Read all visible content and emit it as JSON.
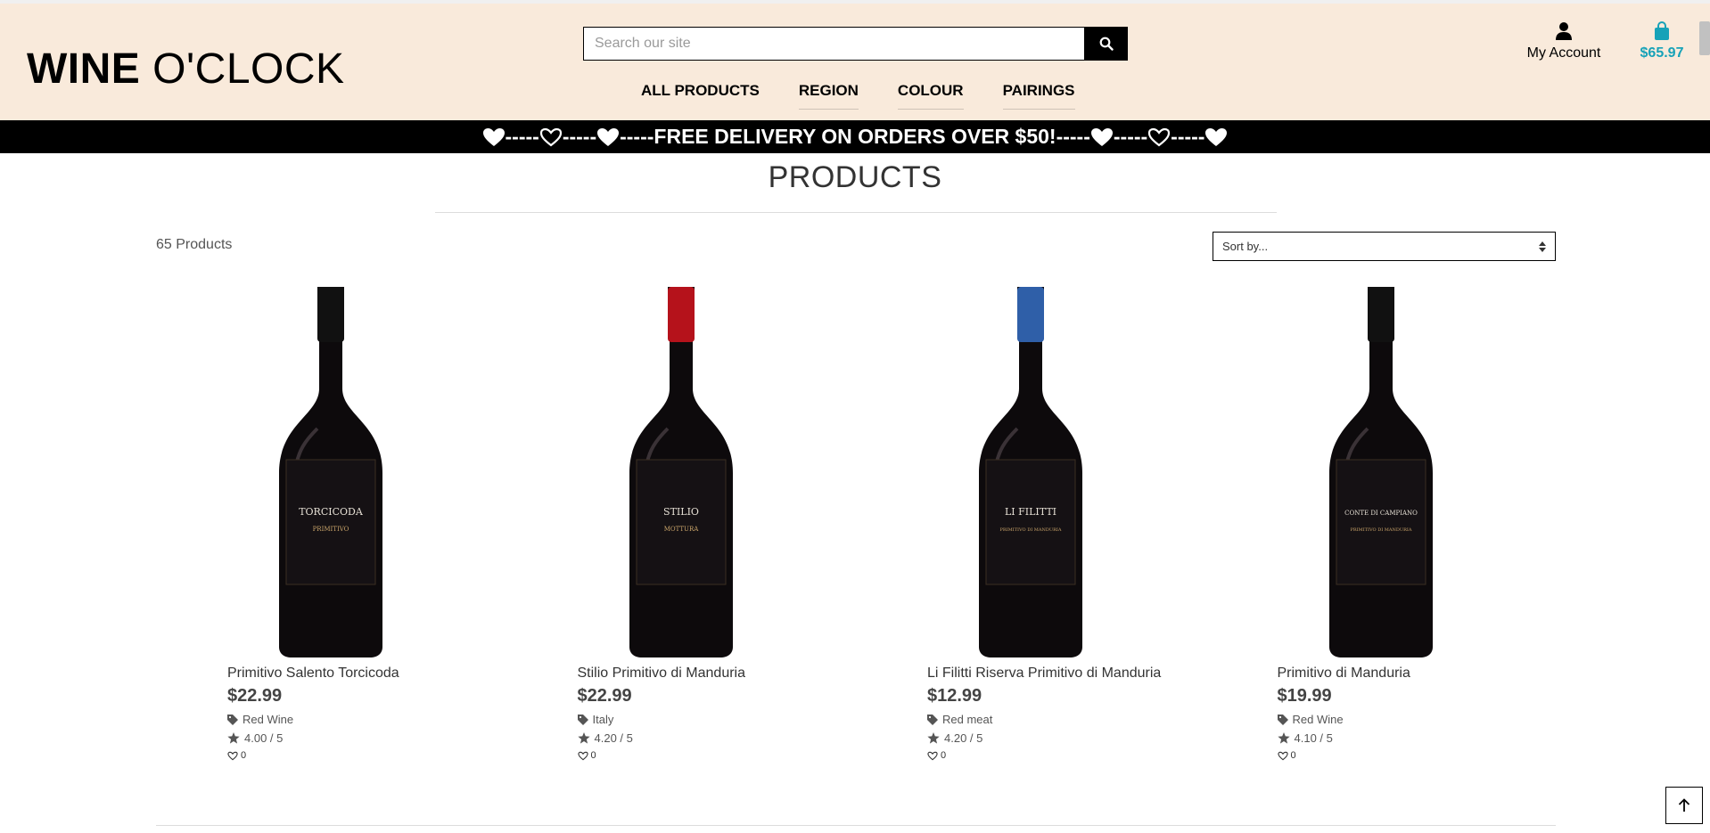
{
  "header": {
    "logo_bold": "WINE",
    "logo_rest": "O'CLOCK",
    "search": {
      "placeholder": "Search our site"
    },
    "nav": [
      {
        "label": "ALL PRODUCTS"
      },
      {
        "label": "REGION"
      },
      {
        "label": "COLOUR"
      },
      {
        "label": "PAIRINGS"
      }
    ],
    "account_label": "My Account",
    "bag_total": "$65.97",
    "bag_color": "#17a2b8"
  },
  "banner": {
    "text": "-----FREE DELIVERY ON ORDERS OVER $50!-----"
  },
  "page": {
    "title": "PRODUCTS",
    "count": "65 Products",
    "sort_label": "Sort by..."
  },
  "products": [
    {
      "name": "Primitivo Salento Torcicoda",
      "price": "$22.99",
      "category": "Red Wine",
      "rating": "4.00 / 5",
      "likes": "0",
      "label_text": "TORCICODA",
      "label_sub": "PRIMITIVO",
      "capsule_color": "#111111"
    },
    {
      "name": "Stilio Primitivo di Manduria",
      "price": "$22.99",
      "category": "Italy",
      "rating": "4.20 / 5",
      "likes": "0",
      "label_text": "STILIO",
      "label_sub": "MOTTURA",
      "capsule_color": "#b5121b"
    },
    {
      "name": "Li Filitti Riserva Primitivo di Manduria",
      "price": "$12.99",
      "category": "Red meat",
      "rating": "4.20 / 5",
      "likes": "0",
      "label_text": "LI FILITTI",
      "label_sub": "PRIMITIVO DI MANDURIA",
      "capsule_color": "#2f5fa8"
    },
    {
      "name": "Primitivo di Manduria",
      "price": "$19.99",
      "category": "Red Wine",
      "rating": "4.10 / 5",
      "likes": "0",
      "label_text": "CONTE DI CAMPIANO",
      "label_sub": "PRIMITIVO DI MANDURIA",
      "capsule_color": "#111111"
    }
  ]
}
